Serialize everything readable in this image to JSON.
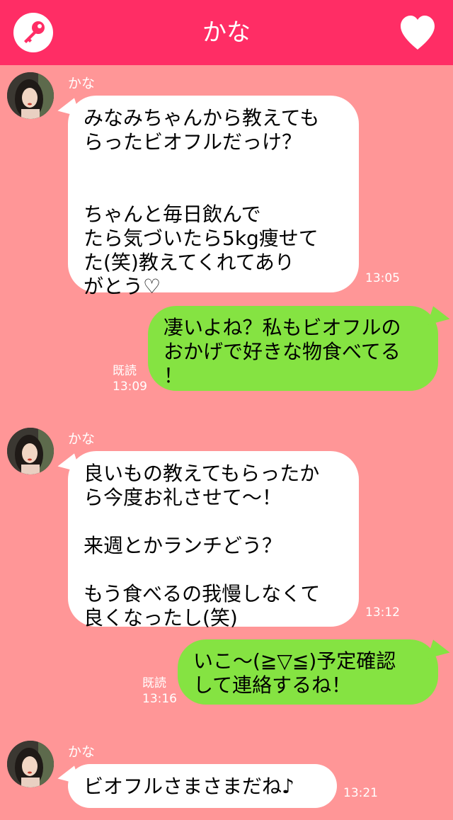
{
  "header": {
    "title": "かな",
    "left_icon": "key-icon",
    "right_icon": "heart-icon",
    "color": "#ff2d65"
  },
  "colors": {
    "background": "#ff9697",
    "incoming_bubble": "#ffffff",
    "outgoing_bubble": "#85e342"
  },
  "messages": [
    {
      "sender": "かな",
      "text": "みなみちゃんから教えても\nらったビオフルだっけ？\n\n\nちゃんと毎日飲んで\nたら気づいたら5kg痩せて\nた(笑)教えてくれてあり\nがとう♡",
      "time": "13:05"
    },
    {
      "text": "凄いよね？私もビオフルの\nおかげで好きな物食べてる\n！",
      "read": "既読",
      "time": "13:09"
    },
    {
      "sender": "かな",
      "text": "良いもの教えてもらったか\nら今度お礼させて〜！\n\n来週とかランチどう？\n\nもう食べるの我慢しなくて\n良くなったし(笑)",
      "time": "13:12"
    },
    {
      "text": "いこ〜(≧▽≦)予定確認\nして連絡するね！",
      "read": "既読",
      "time": "13:16"
    },
    {
      "sender": "かな",
      "text": "ビオフルさまさまだね♪",
      "time": "13:21"
    }
  ]
}
